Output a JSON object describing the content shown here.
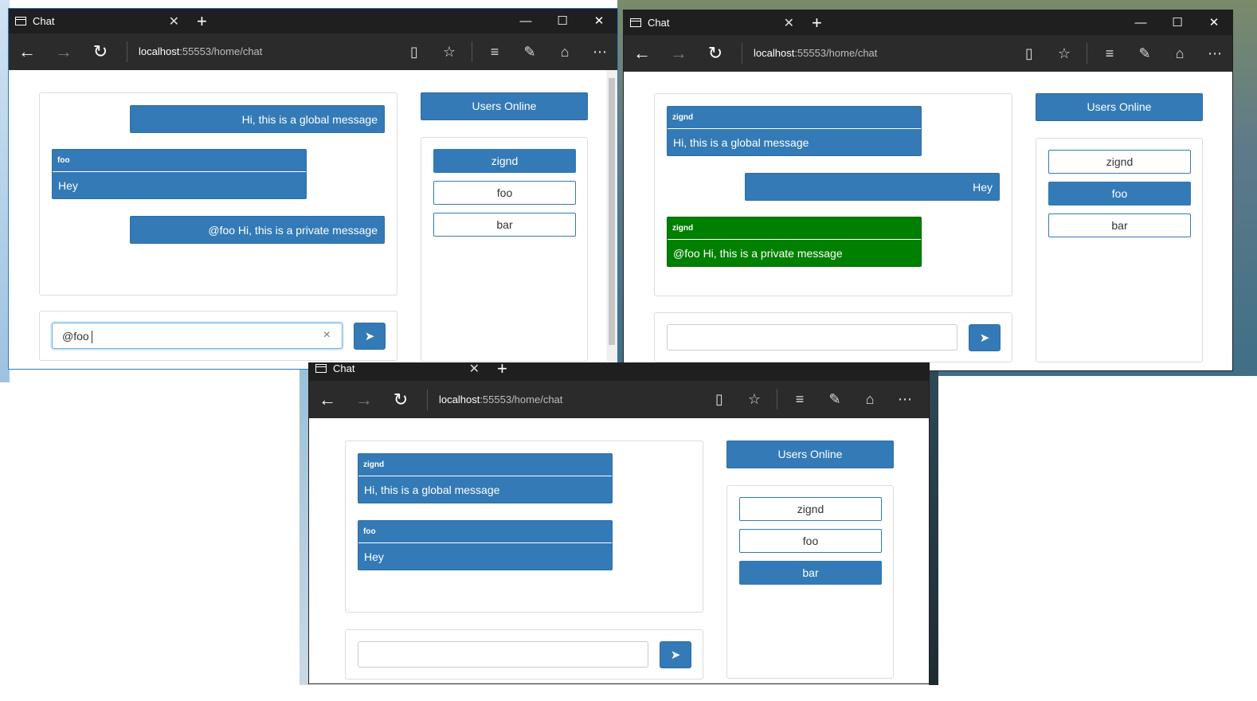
{
  "windows": [
    {
      "tab_title": "Chat",
      "url_host": "localhost",
      "url_rest": ":55553/home/chat",
      "messages": [
        {
          "text": "Hi, this is a global message"
        },
        {
          "author": "foo",
          "text": "Hey"
        },
        {
          "text": "@foo Hi, this is a private message"
        }
      ],
      "users_header": "Users Online",
      "users": [
        "zignd",
        "foo",
        "bar"
      ],
      "active_user": "zignd",
      "input_value": "@foo",
      "clear_glyph": "×"
    },
    {
      "tab_title": "Chat",
      "url_host": "localhost",
      "url_rest": ":55553/home/chat",
      "messages": [
        {
          "author": "zignd",
          "text": "Hi, this is a global message"
        },
        {
          "text": "Hey"
        },
        {
          "author": "zignd",
          "text": "@foo Hi, this is a private message",
          "private": true
        }
      ],
      "users_header": "Users Online",
      "users": [
        "zignd",
        "foo",
        "bar"
      ],
      "active_user": "foo",
      "input_value": ""
    },
    {
      "tab_title": "Chat",
      "url_host": "localhost",
      "url_rest": ":55553/home/chat",
      "messages": [
        {
          "author": "zignd",
          "text": "Hi, this is a global message"
        },
        {
          "author": "foo",
          "text": "Hey"
        }
      ],
      "users_header": "Users Online",
      "users": [
        "zignd",
        "foo",
        "bar"
      ],
      "active_user": "bar",
      "input_value": ""
    }
  ],
  "colors": {
    "primary": "#337ab7",
    "private": "#008000",
    "chrome_dark": "#1f1f1f"
  },
  "icons": [
    "tab-page-icon",
    "close-tab-icon",
    "new-tab-icon",
    "minimize-icon",
    "maximize-icon",
    "close-window-icon",
    "back-icon",
    "forward-icon",
    "refresh-icon",
    "reading-view-icon",
    "favorite-star-icon",
    "hub-icon",
    "web-note-icon",
    "share-icon",
    "more-icon",
    "send-paper-plane-icon"
  ]
}
